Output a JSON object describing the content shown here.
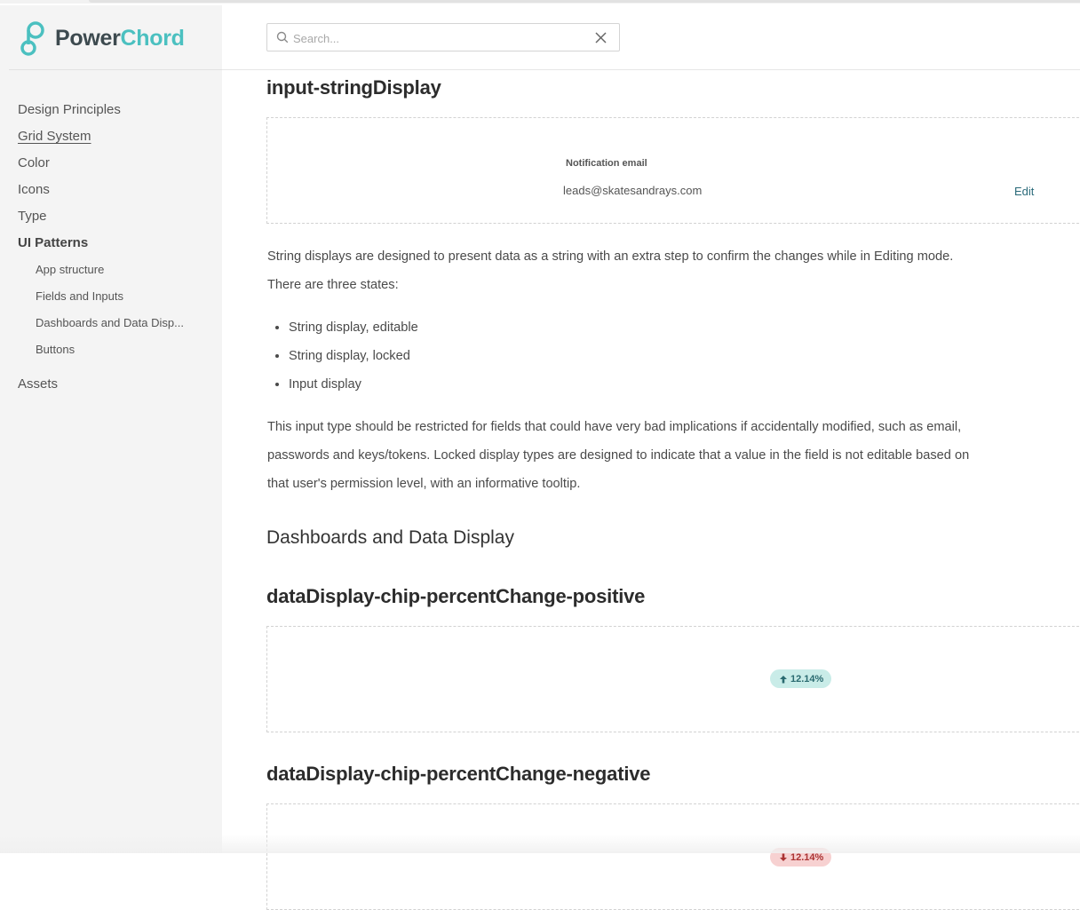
{
  "brand": {
    "logo_power": "Power",
    "logo_chord": "Chord",
    "accent": "#4bc0c0"
  },
  "search": {
    "placeholder": "Search...",
    "value": ""
  },
  "sidebar": {
    "items": [
      {
        "label": "Design Principles"
      },
      {
        "label": "Grid System"
      },
      {
        "label": "Color"
      },
      {
        "label": "Icons"
      },
      {
        "label": "Type"
      },
      {
        "label": "UI Patterns"
      }
    ],
    "sub_items": [
      {
        "label": "App structure"
      },
      {
        "label": "Fields and Inputs"
      },
      {
        "label": "Dashboards and Data Disp..."
      },
      {
        "label": "Buttons"
      }
    ],
    "assets": {
      "label": "Assets"
    }
  },
  "main": {
    "section1": {
      "title": "input-stringDisplay",
      "demo": {
        "field_label": "Notification email",
        "field_value": "leads@skatesandrays.com",
        "edit_label": "Edit"
      },
      "paragraph1": "String displays are designed to present data as a string with an extra step to confirm the changes while in Editing mode. There are three states:",
      "bullets": [
        "String display, editable",
        "String display, locked",
        "Input display"
      ],
      "paragraph2": "This input type should be restricted for fields that could have very bad implications if accidentally modified, such as email, passwords and keys/tokens. Locked display types are designed to indicate that a value in the field is not editable based on that user's permission level, with an informative tooltip."
    },
    "heading": "Dashboards and Data Display",
    "section2": {
      "title": "dataDisplay-chip-percentChange-positive",
      "chip_value": "12.14%",
      "chip_color": "#c9ece8"
    },
    "section3": {
      "title": "dataDisplay-chip-percentChange-negative",
      "chip_value": "12.14%",
      "chip_color": "#f7d1d1"
    }
  }
}
